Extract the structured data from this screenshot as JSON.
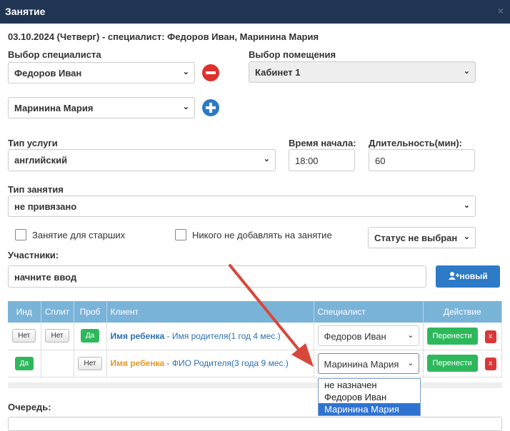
{
  "title": "Занятие",
  "close": "×",
  "header": "03.10.2024 (Четверг) - специалист: Федоров Иван, Маринина Мария",
  "specialist_label": "Выбор специалиста",
  "specialist1": "Федоров Иван",
  "specialist2": "Маринина Мария",
  "room_label": "Выбор помещения",
  "room": "Кабинет 1",
  "service_label": "Тип услуги",
  "service": "английский",
  "start_label": "Время начала:",
  "start": "18:00",
  "duration_label": "Длительность(мин):",
  "duration": "60",
  "lesson_type_label": "Тип занятия",
  "lesson_type": "не привязано",
  "cb_senior": "Занятие для старших",
  "cb_noone": "Никого не добавлять на занятие",
  "status": "Статус не выбран",
  "participants_label": "Участники:",
  "participants_placeholder": "начните ввод",
  "new_button": "новый",
  "table": {
    "headers": [
      "Инд",
      "Сплит",
      "Проб",
      "Клиент",
      "Специалист",
      "Действие"
    ],
    "rows": [
      {
        "ind": "Нет",
        "split": "Нет",
        "trial": "Да",
        "child": "Имя ребенка",
        "sep": " - ",
        "parent": "Имя родителя(1 год 4 мес.)",
        "specialist": "Федоров Иван",
        "move": "Перенести",
        "del": "x"
      },
      {
        "ind": "Да",
        "split": "",
        "trial": "Нет",
        "child": "Имя ребенка",
        "sep": " - ",
        "parent": "ФИО Родителя(3 года 9 мес.)",
        "specialist": "Маринина Мария",
        "move": "Перенести",
        "del": "x"
      }
    ]
  },
  "dropdown_options": [
    "не назначен",
    "Федоров Иван",
    "Маринина Мария"
  ],
  "queue_label": "Очередь:",
  "colors": {
    "titlebar": "#1f3553",
    "accent": "#2d7ac6",
    "green": "#2eb85c",
    "red": "#d9383a",
    "arrow": "#d8473b"
  }
}
